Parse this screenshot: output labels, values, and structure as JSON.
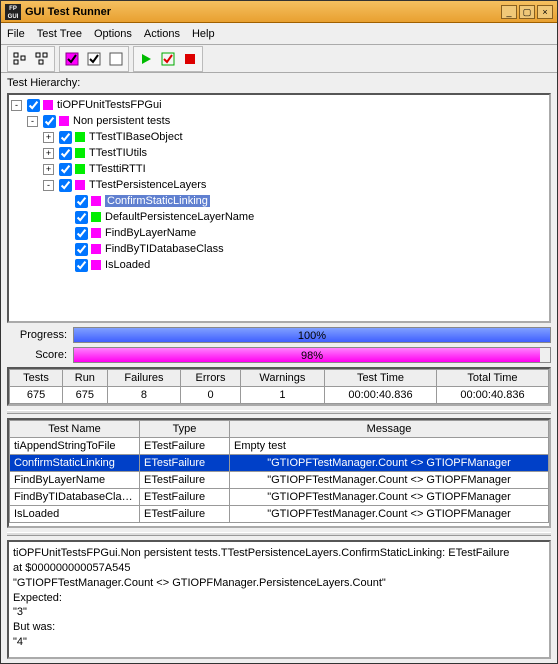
{
  "window": {
    "title": "GUI Test Runner"
  },
  "menu": {
    "file": "File",
    "testtree": "Test Tree",
    "options": "Options",
    "actions": "Actions",
    "help": "Help"
  },
  "hierarchy_label": "Test Hierarchy:",
  "tree": {
    "root": "tiOPFUnitTestsFPGui",
    "nonpersistent": "Non persistent tests",
    "n1": "TTestTIBaseObject",
    "n2": "TTestTIUtils",
    "n3": "TTesttiRTTI",
    "n4": "TTestPersistenceLayers",
    "c1": "ConfirmStaticLinking",
    "c2": "DefaultPersistenceLayerName",
    "c3": "FindByLayerName",
    "c4": "FindByTIDatabaseClass",
    "c5": "IsLoaded"
  },
  "progress": {
    "label": "Progress:",
    "text": "100%",
    "pct": 100
  },
  "score": {
    "label": "Score:",
    "text": "98%",
    "pct": 98
  },
  "stats": {
    "headers": {
      "tests": "Tests",
      "run": "Run",
      "failures": "Failures",
      "errors": "Errors",
      "warnings": "Warnings",
      "testtime": "Test Time",
      "totaltime": "Total Time"
    },
    "values": {
      "tests": "675",
      "run": "675",
      "failures": "8",
      "errors": "0",
      "warnings": "1",
      "testtime": "00:00:40.836",
      "totaltime": "00:00:40.836"
    }
  },
  "failures": {
    "headers": {
      "name": "Test Name",
      "type": "Type",
      "message": "Message"
    },
    "rows": [
      {
        "name": "tiAppendStringToFile",
        "type": "ETestFailure",
        "msg": "Empty test"
      },
      {
        "name": "ConfirmStaticLinking",
        "type": "ETestFailure",
        "msg": "\"GTIOPFTestManager.Count <> GTIOPFManager"
      },
      {
        "name": "FindByLayerName",
        "type": "ETestFailure",
        "msg": "\"GTIOPFTestManager.Count <> GTIOPFManager"
      },
      {
        "name": "FindByTIDatabaseCla…",
        "type": "ETestFailure",
        "msg": "\"GTIOPFTestManager.Count <> GTIOPFManager"
      },
      {
        "name": "IsLoaded",
        "type": "ETestFailure",
        "msg": "\"GTIOPFTestManager.Count <> GTIOPFManager"
      }
    ]
  },
  "details": {
    "l1": "tiOPFUnitTestsFPGui.Non persistent tests.TTestPersistenceLayers.ConfirmStaticLinking: ETestFailure",
    "l2": "at $000000000057A545",
    "l3": "  \"GTIOPFTestManager.Count <> GTIOPFManager.PersistenceLayers.Count\"",
    "l4": "Expected:",
    "l5": "  \"3\"",
    "l6": "But was:",
    "l7": "  \"4\""
  },
  "chart_data": {
    "type": "table",
    "title": "Test run summary",
    "categories": [
      "Tests",
      "Run",
      "Failures",
      "Errors",
      "Warnings",
      "Test Time",
      "Total Time"
    ],
    "values": [
      675,
      675,
      8,
      0,
      1,
      "00:00:40.836",
      "00:00:40.836"
    ]
  }
}
